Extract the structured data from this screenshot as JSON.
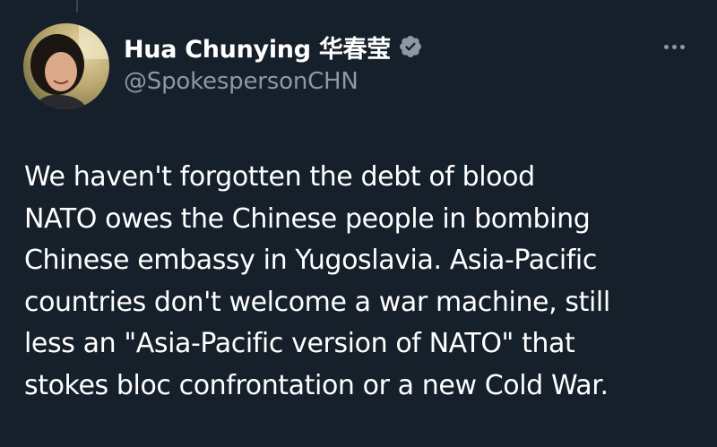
{
  "author": {
    "display_name": "Hua Chunying 华春莹",
    "handle": "@SpokespersonCHN",
    "verified_icon": "verified-badge-icon",
    "avatar_icon": "profile-photo"
  },
  "more_menu_icon": "more-horizontal-icon",
  "tweet": {
    "lines": [
      "We haven't forgotten the debt of blood",
      "NATO owes the Chinese people in bombing",
      "Chinese embassy in Yugoslavia. Asia-Pacific",
      "countries don't welcome a war machine, still",
      "less an \"Asia-Pacific version of NATO\" that",
      "stokes bloc confrontation or a new Cold War."
    ]
  },
  "colors": {
    "background": "#15202b",
    "text": "#ffffff",
    "secondary_text": "#8b98a5",
    "verified": "#8b98a5"
  }
}
